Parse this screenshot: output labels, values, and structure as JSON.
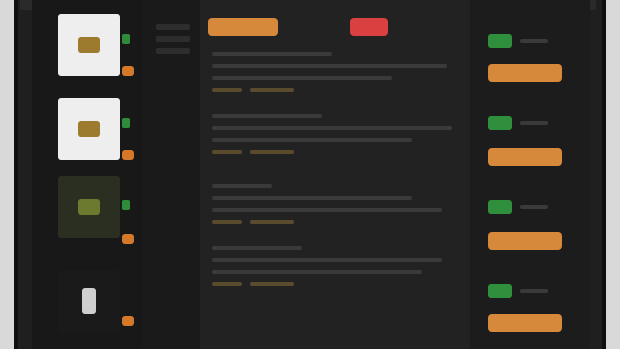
{
  "tabs": [
    {
      "label": "",
      "style": "orange"
    },
    {
      "label": "",
      "style": "plain"
    },
    {
      "label": "",
      "style": "red"
    }
  ],
  "rows": [
    {
      "thumb": "light"
    },
    {
      "thumb": "light"
    },
    {
      "thumb": "dark"
    },
    {
      "thumb": "blank"
    }
  ],
  "status_labels": [
    "",
    "",
    "",
    ""
  ],
  "action_labels": [
    "",
    "",
    "",
    ""
  ],
  "colors": {
    "accent": "#d7893b",
    "alert": "#d94141",
    "online": "#2f8f3c",
    "background": "#1f1f1f"
  },
  "icons": [
    "image-thumbnail-icon"
  ]
}
